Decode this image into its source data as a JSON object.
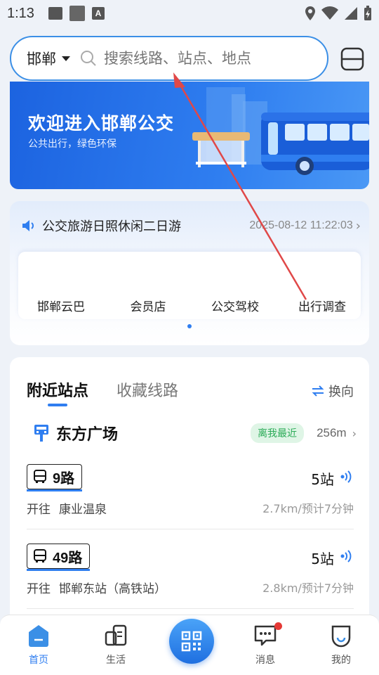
{
  "status_bar": {
    "time": "1:13"
  },
  "header": {
    "city": "邯郸",
    "search_placeholder": "搜索线路、站点、地点"
  },
  "banner": {
    "title": "欢迎进入邯郸公交",
    "subtitle": "公共出行，绿色环保"
  },
  "notice": {
    "text": "公交旅游日照休闲二日游",
    "time": "2025-08-12 11:22:03"
  },
  "quick_links": [
    {
      "label": "邯郸云巴"
    },
    {
      "label": "会员店"
    },
    {
      "label": "公交驾校"
    },
    {
      "label": "出行调查"
    }
  ],
  "nearby": {
    "tabs": [
      {
        "label": "附近站点",
        "active": true
      },
      {
        "label": "收藏线路",
        "active": false
      }
    ],
    "switch_label": "换向",
    "station": {
      "name": "东方广场",
      "badge": "离我最近",
      "distance": "256m"
    },
    "routes": [
      {
        "name": "9路",
        "stops": "5站",
        "direction_label": "开往",
        "destination": "康业温泉",
        "eta": "2.7km/预计7分钟"
      },
      {
        "name": "49路",
        "stops": "5站",
        "direction_label": "开往",
        "destination": "邯郸东站（高铁站）",
        "eta": "2.8km/预计7分钟"
      }
    ]
  },
  "bottom_nav": [
    {
      "label": "首页",
      "icon": "home-icon",
      "active": true
    },
    {
      "label": "生活",
      "icon": "life-icon",
      "active": false
    },
    {
      "label": "",
      "icon": "qr-code-icon",
      "active": false
    },
    {
      "label": "消息",
      "icon": "message-icon",
      "active": false
    },
    {
      "label": "我的",
      "icon": "profile-icon",
      "active": false
    }
  ],
  "colors": {
    "accent": "#2f7ef0",
    "banner": "#1c63e0",
    "badge_green": "#2bab57",
    "notification": "#e53935",
    "annotation_arrow": "#e04848"
  }
}
